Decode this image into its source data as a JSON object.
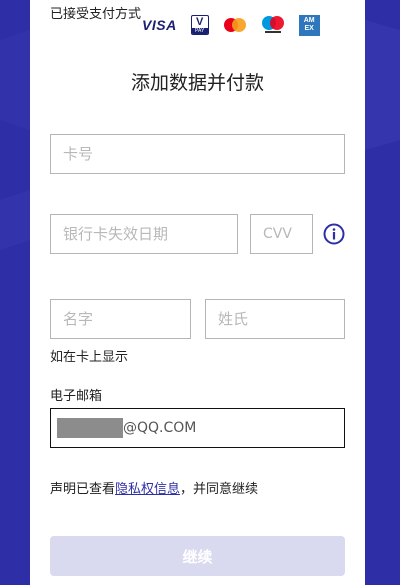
{
  "payment_methods": {
    "label": "已接受支付方式",
    "logos": [
      "visa-logo",
      "vpay-logo",
      "mastercard-logo",
      "maestro-logo",
      "amex-logo"
    ],
    "visa_text": "VISA",
    "vpay_v": "V",
    "vpay_pay": "PAY",
    "amex_top": "AM",
    "amex_bottom": "EX"
  },
  "form": {
    "title": "添加数据并付款",
    "card_number_placeholder": "卡号",
    "expiry_placeholder": "银行卡失效日期",
    "cvv_placeholder": "CVV",
    "first_name_placeholder": "名字",
    "last_name_placeholder": "姓氏",
    "name_hint": "如在卡上显示",
    "email_label": "电子邮箱",
    "email_domain": "@QQ.COM",
    "consent_before": "声明已查看",
    "consent_link": "隐私权信息",
    "consent_after": "，并同意继续",
    "continue_label": "继续"
  },
  "colors": {
    "background": "#2e2fa6",
    "card": "#ffffff",
    "link": "#2e2fa6",
    "button_disabled": "#d9d9f0"
  }
}
